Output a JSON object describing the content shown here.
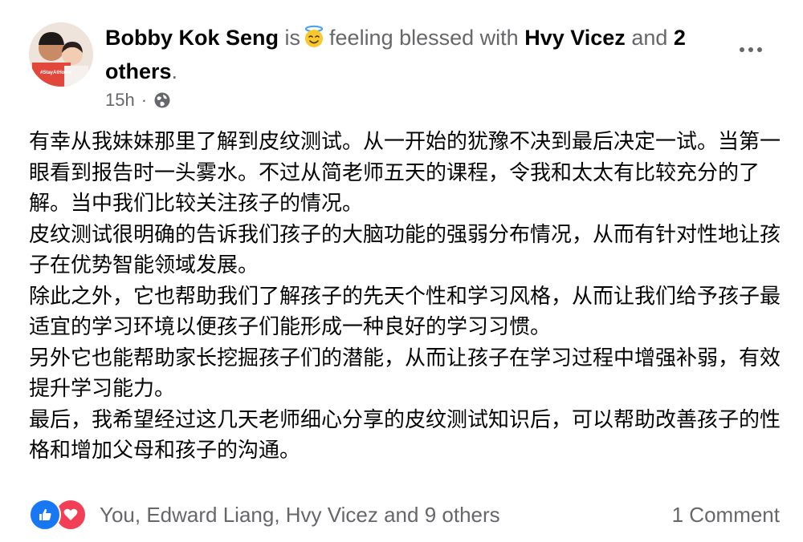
{
  "post": {
    "author": "Bobby Kok Seng",
    "is_text": "is",
    "feeling_icon": "smiling-face-with-halo",
    "feeling_text": "feeling blessed with",
    "tagged_person": "Hvy Vicez",
    "and_text": "and",
    "others_text": "2 others",
    "period": ".",
    "timestamp": "15h",
    "separator": "·",
    "privacy_icon": "globe-icon",
    "avatar_badge": "#StayAtHome",
    "body": [
      "有幸从我妹妹那里了解到皮纹测试。从一开始的犹豫不决到最后决定一试。当第一眼看到报告时一头雾水。不过从简老师五天的课程，令我和太太有比较充分的了解。当中我们比较关注孩子的情况。",
      "皮纹测试很明确的告诉我们孩子的大脑功能的强弱分布情况，从而有针对性地让孩子在优势智能领域发展。",
      "除此之外，它也帮助我们了解孩子的先天个性和学习风格，从而让我们给予孩子最适宜的学习环境以便孩子们能形成一种良好的学习习惯。",
      "另外它也能帮助家长挖掘孩子们的潜能，从而让孩子在学习过程中增强补弱，有效提升学习能力。",
      "最后，我希望经过这几天老师细心分享的皮纹测试知识后，可以帮助改善孩子的性格和增加父母和孩子的沟通。"
    ],
    "reactions": {
      "icons": [
        "like-icon",
        "love-icon"
      ],
      "summary": "You, Edward Liang, Hvy Vicez and 9 others"
    },
    "comments_label": "1 Comment"
  },
  "colors": {
    "primary_text": "#050505",
    "secondary_text": "#65676b",
    "like_blue": "#1877f2",
    "love_red": "#f33e58"
  }
}
